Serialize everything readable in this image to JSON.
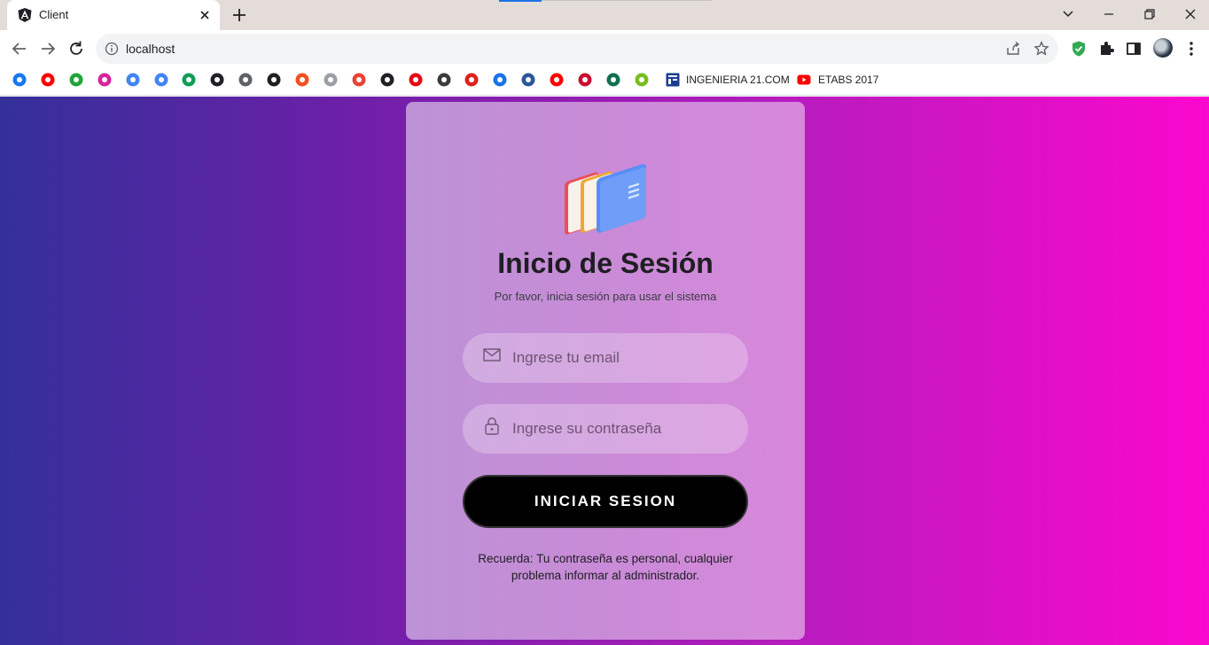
{
  "browser": {
    "tab_title": "Client",
    "url": "localhost",
    "bookmarks": [
      {
        "name": "facebook-bookmark-icon",
        "color": "#1877f2"
      },
      {
        "name": "youtube-bookmark-icon",
        "color": "#ff0000"
      },
      {
        "name": "green-one-bookmark-icon",
        "color": "#1fa53a"
      },
      {
        "name": "instagram-bookmark-icon",
        "color": "#d6249f"
      },
      {
        "name": "google-bookmark-icon",
        "color": "#4285f4"
      },
      {
        "name": "google-bookmark-icon-2",
        "color": "#4285f4"
      },
      {
        "name": "google-drive-bookmark-icon",
        "color": "#0f9d58"
      },
      {
        "name": "gauge-bookmark-icon",
        "color": "#202124"
      },
      {
        "name": "circle-logo-bookmark-icon",
        "color": "#5f6368"
      },
      {
        "name": "globe-bookmark-icon",
        "color": "#202124"
      },
      {
        "name": "microsoft-bookmark-icon",
        "color": "#f25022"
      },
      {
        "name": "audio-bookmark-icon",
        "color": "#9aa0a6"
      },
      {
        "name": "gmail-bookmark-icon",
        "color": "#ea4335"
      },
      {
        "name": "github-bookmark-icon",
        "color": "#202124"
      },
      {
        "name": "netflix-bookmark-icon",
        "color": "#e50914"
      },
      {
        "name": "dark-circle-bookmark-icon",
        "color": "#3c3c3c"
      },
      {
        "name": "red-m-bookmark-icon",
        "color": "#e0201b"
      },
      {
        "name": "blue-swirl-bookmark-icon",
        "color": "#1a73e8"
      },
      {
        "name": "word-bookmark-icon",
        "color": "#2b579a"
      },
      {
        "name": "youtube-bookmark-icon-2",
        "color": "#ff0000"
      },
      {
        "name": "nba-tv-bookmark-icon",
        "color": "#c8102e"
      },
      {
        "name": "bet365-bookmark-icon",
        "color": "#126e51"
      },
      {
        "name": "utorrent-bookmark-icon",
        "color": "#78be20"
      }
    ],
    "labeled_bookmarks": [
      {
        "label": "INGENIERIA 21.COM"
      },
      {
        "label": "ETABS 2017"
      }
    ]
  },
  "login": {
    "title": "Inicio de Sesión",
    "subtitle": "Por favor, inicia sesión para usar el sistema",
    "email_placeholder": "Ingrese tu email",
    "password_placeholder": "Ingrese su contraseña",
    "button_label": "INICIAR SESION",
    "note": "Recuerda: Tu contraseña es personal, cualquier problema informar al administrador."
  },
  "colors": {
    "page_gradient_start": "#33309a",
    "page_gradient_end": "#fb07cd",
    "button": "#000000"
  }
}
